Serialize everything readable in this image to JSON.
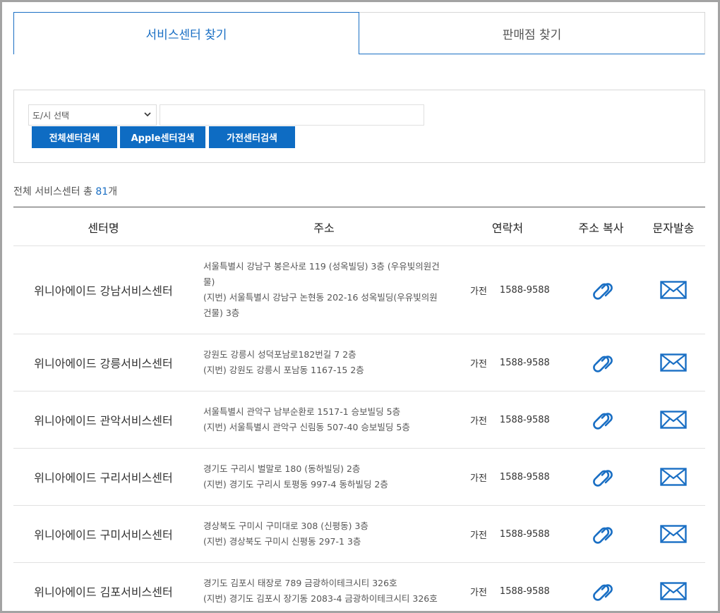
{
  "tabs": [
    {
      "label": "서비스센터 찾기",
      "active": true
    },
    {
      "label": "판매점 찾기",
      "active": false
    }
  ],
  "search": {
    "city_select_value": "도/시 선택",
    "keyword_value": "",
    "buttons": [
      "전체센터검색",
      "Apple센터검색",
      "가전센터검색"
    ]
  },
  "total": {
    "prefix": "전체 서비스센터 총 ",
    "count": "81",
    "suffix": "개"
  },
  "table": {
    "headers": {
      "name": "센터명",
      "address": "주소",
      "contact": "연락처",
      "copy": "주소 복사",
      "sms": "문자발송"
    },
    "rows": [
      {
        "name": "위니아에이드 강남서비스센터",
        "address": "서울특별시 강남구 봉은사로 119 (성옥빌딩) 3층 (우유빛의원건물)",
        "address_lot": "(지번) 서울특별시 강남구 논현동 202-16 성옥빌딩(우유빛의원건물) 3층",
        "type": "가전",
        "phone": "1588-9588"
      },
      {
        "name": "위니아에이드 강릉서비스센터",
        "address": "강원도 강릉시 성덕포남로182번길 7 2층",
        "address_lot": "(지번) 강원도 강릉시 포남동 1167-15 2층",
        "type": "가전",
        "phone": "1588-9588"
      },
      {
        "name": "위니아에이드 관악서비스센터",
        "address": "서울특별시 관악구 남부순환로 1517-1 승보빌딩 5층",
        "address_lot": "(지번) 서울특별시 관악구 신림동 507-40 승보빌딩 5층",
        "type": "가전",
        "phone": "1588-9588"
      },
      {
        "name": "위니아에이드 구리서비스센터",
        "address": "경기도 구리시 벌말로 180 (동하빌딩) 2층",
        "address_lot": "(지번) 경기도 구리시 토평동 997-4 동하빌딩 2층",
        "type": "가전",
        "phone": "1588-9588"
      },
      {
        "name": "위니아에이드 구미서비스센터",
        "address": "경상북도 구미시 구미대로 308 (신평동) 3층",
        "address_lot": "(지번) 경상북도 구미시 신평동 297-1 3층",
        "type": "가전",
        "phone": "1588-9588"
      },
      {
        "name": "위니아에이드 김포서비스센터",
        "address": "경기도 김포시 태장로 789 금광하이테크시티 326호",
        "address_lot": "(지번) 경기도 김포시 장기동 2083-4 금광하이테크시티 326호",
        "type": "가전",
        "phone": "1588-9588"
      }
    ]
  },
  "icons": {
    "copy": "link-icon",
    "sms": "envelope-icon",
    "select": "chevron-down-icon"
  },
  "colors": {
    "accent": "#1a6fc4",
    "button": "#0e6cc3"
  }
}
